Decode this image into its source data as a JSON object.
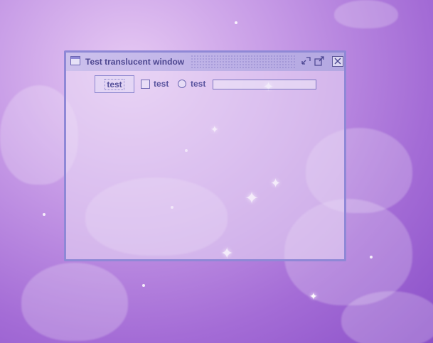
{
  "window": {
    "title": "Test translucent window",
    "icons": {
      "window": "window-icon",
      "minimize": "minimize-icon",
      "maximize": "maximize-icon",
      "close": "close-icon"
    }
  },
  "content": {
    "button_label": "test",
    "checkbox": {
      "label": "test",
      "checked": false
    },
    "radio": {
      "label": "test",
      "selected": false
    },
    "text_field": {
      "value": ""
    }
  },
  "colors": {
    "window_border": "#8f88d6",
    "title_text": "#4d4790",
    "background": "#a46cd6"
  }
}
